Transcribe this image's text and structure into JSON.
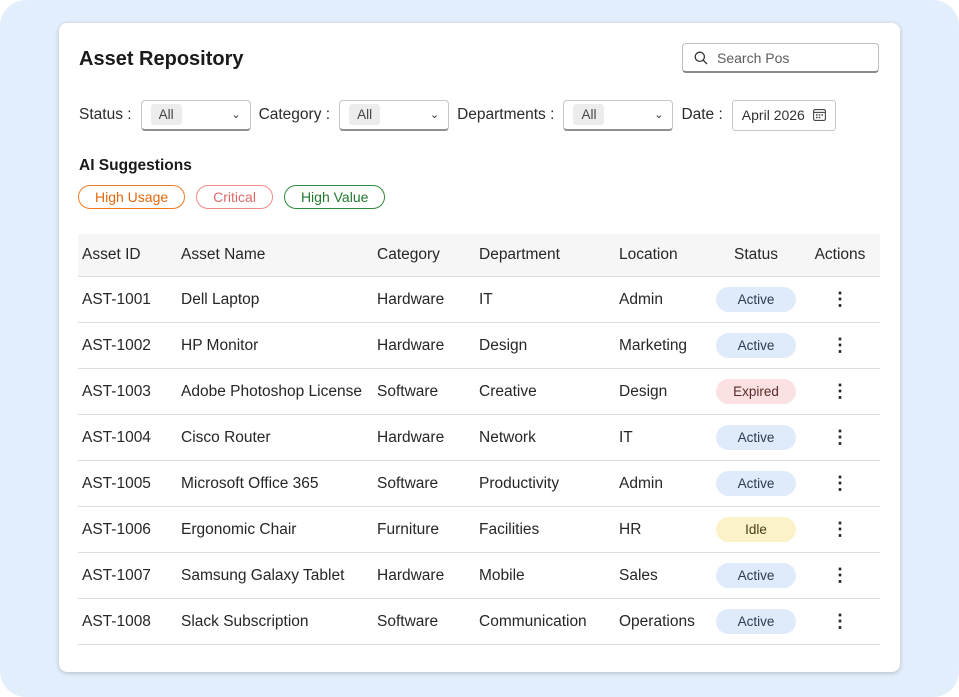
{
  "page": {
    "title": "Asset Repository"
  },
  "search": {
    "placeholder": "Search Pos",
    "icon": "search-icon"
  },
  "filters": {
    "status": {
      "label": "Status :",
      "value": "All"
    },
    "category": {
      "label": "Category :",
      "value": "All"
    },
    "departments": {
      "label": "Departments :",
      "value": "All"
    },
    "date": {
      "label": "Date :",
      "value": "April 2026",
      "icon": "calendar-icon"
    }
  },
  "ai_suggestions": {
    "title": "AI Suggestions",
    "tags": [
      "High Usage",
      "Critical",
      "High Value"
    ],
    "colors": {
      "high_usage": "#f07a21",
      "critical": "#f08a8a",
      "high_value": "#2e8a3c"
    }
  },
  "table": {
    "columns": [
      "Asset ID",
      "Asset Name",
      "Category",
      "Department",
      "Location",
      "Status",
      "Actions"
    ],
    "rows": [
      {
        "id": "AST-1001",
        "name": "Dell Laptop",
        "category": "Hardware",
        "department": "IT",
        "location": "Admin",
        "status": "Active"
      },
      {
        "id": "AST-1002",
        "name": "HP Monitor",
        "category": "Hardware",
        "department": "Design",
        "location": "Marketing",
        "status": "Active"
      },
      {
        "id": "AST-1003",
        "name": "Adobe Photoshop License",
        "category": "Software",
        "department": "Creative",
        "location": "Design",
        "status": "Expired"
      },
      {
        "id": "AST-1004",
        "name": "Cisco Router",
        "category": "Hardware",
        "department": "Network",
        "location": "IT",
        "status": "Active"
      },
      {
        "id": "AST-1005",
        "name": "Microsoft Office 365",
        "category": "Software",
        "department": "Productivity",
        "location": "Admin",
        "status": "Active"
      },
      {
        "id": "AST-1006",
        "name": "Ergonomic Chair",
        "category": "Furniture",
        "department": "Facilities",
        "location": "HR",
        "status": "Idle"
      },
      {
        "id": "AST-1007",
        "name": "Samsung Galaxy Tablet",
        "category": "Hardware",
        "department": "Mobile",
        "location": "Sales",
        "status": "Active"
      },
      {
        "id": "AST-1008",
        "name": "Slack Subscription",
        "category": "Software",
        "department": "Communication",
        "location": "Operations",
        "status": "Active"
      }
    ],
    "status_colors": {
      "Active": "#dfeafa",
      "Expired": "#fbe1e1",
      "Idle": "#fcf2c9"
    },
    "action_icon": "more-vertical-icon"
  }
}
